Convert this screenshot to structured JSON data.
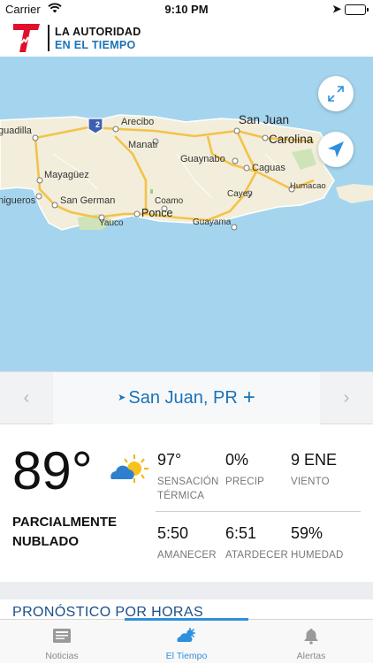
{
  "status_bar": {
    "carrier": "Carrier",
    "time": "9:10 PM"
  },
  "header": {
    "brand_line1": "LA AUTORIDAD",
    "brand_line2": "EN EL TIEMPO"
  },
  "map": {
    "route_shield": "2",
    "cities": [
      {
        "name": "guadilla"
      },
      {
        "name": "Arecibo"
      },
      {
        "name": "San Juan"
      },
      {
        "name": "Carolina"
      },
      {
        "name": "Manati"
      },
      {
        "name": "Guaynabo"
      },
      {
        "name": "Caguas"
      },
      {
        "name": "Mayagüez"
      },
      {
        "name": "Humacao"
      },
      {
        "name": "nigueros"
      },
      {
        "name": "San German"
      },
      {
        "name": "Cayey"
      },
      {
        "name": "Coamo"
      },
      {
        "name": "Ponce"
      },
      {
        "name": "Yauco"
      },
      {
        "name": "Guayama"
      }
    ]
  },
  "location_bar": {
    "location": "San Juan, PR",
    "plus": "+",
    "prev": "‹",
    "next": "›"
  },
  "current": {
    "temperature": "89°",
    "condition": "PARCIALMENTE NUBLADO",
    "stats": [
      {
        "value": "97°",
        "label": "SENSACIÓN TÉRMICA"
      },
      {
        "value": "0%",
        "label": "PRECIP"
      },
      {
        "value": "9 ENE",
        "label": "VIENTO"
      },
      {
        "value": "5:50",
        "label": "AMANECER"
      },
      {
        "value": "6:51",
        "label": "ATARDECER"
      },
      {
        "value": "59%",
        "label": "HUMEDAD"
      }
    ]
  },
  "hourly": {
    "title": "PRONÓSTICO POR HORAS"
  },
  "tabs": [
    {
      "label": "Noticias",
      "icon": "news-icon",
      "active": false
    },
    {
      "label": "El Tiempo",
      "icon": "weather-icon",
      "active": true
    },
    {
      "label": "Alertas",
      "icon": "bell-icon",
      "active": false
    }
  ],
  "colors": {
    "accent": "#2f8fdc",
    "brand_blue": "#1a73b8",
    "brand_red": "#e0102a",
    "water": "#a5d5ee",
    "land": "#f2eedb"
  }
}
